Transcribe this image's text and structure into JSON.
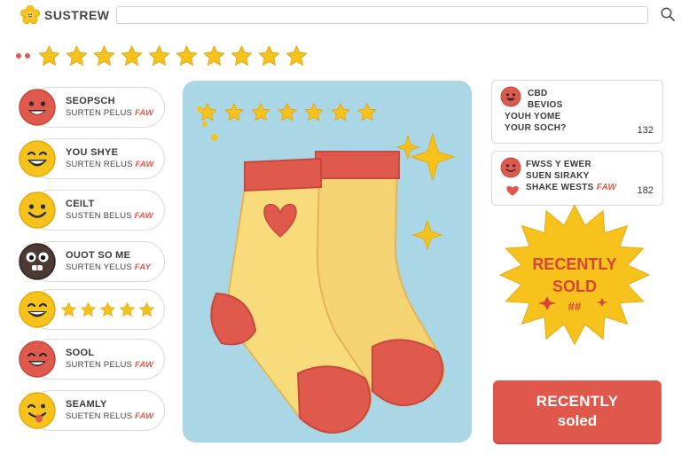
{
  "brand": {
    "name": "SUSTREW"
  },
  "search": {
    "value": "",
    "icon": "search-icon"
  },
  "top_rating": {
    "stars": 10
  },
  "left_list": [
    {
      "title": "SEOPSCH",
      "sub": "SURTEN PELUS",
      "accent": "FAW",
      "face": "red-happy"
    },
    {
      "title": "YOU SHYE",
      "sub": "SURTEN RELUS",
      "accent": "FAW",
      "face": "yellow-laugh"
    },
    {
      "title": "CEILT",
      "sub": "SUSTEN BELUS",
      "accent": "FAW",
      "face": "yellow-smile"
    },
    {
      "title": "OUOT SO ME",
      "sub": "SURTEN YELUS",
      "accent": "FAY",
      "face": "dark-funny"
    },
    {
      "stars": 5,
      "face": "yellow-grin"
    },
    {
      "title": "SOOL",
      "sub": "SURTEN PELUS",
      "accent": "FAW",
      "face": "red-smile"
    },
    {
      "title": "SEAMLY",
      "sub": "SUETEN RELUS",
      "accent": "FAW",
      "face": "yellow-tongue"
    }
  ],
  "product": {
    "stars": 7
  },
  "reviews": [
    {
      "lines": [
        "CBD",
        "BEVIOS",
        "YOUH YOME",
        "YOUR SOCH?"
      ],
      "count": "132",
      "face": "red-happy"
    },
    {
      "lines": [
        "FWSS Y EWER",
        "SUEN SIRAKY"
      ],
      "last": "SHAKE WESTS",
      "accent": "FAW",
      "count": "182",
      "face": "red-smile"
    }
  ],
  "badge": {
    "line1": "RECENTLY",
    "line2": "SOLD",
    "hash": "##"
  },
  "cta": {
    "line1": "RECENTLY",
    "line2": "soled"
  },
  "colors": {
    "accent": "#e0594d",
    "star": "#f7c21c",
    "panel": "#a9d7e6",
    "sock": "#f8dc7c",
    "cuff": "#e0594d"
  }
}
